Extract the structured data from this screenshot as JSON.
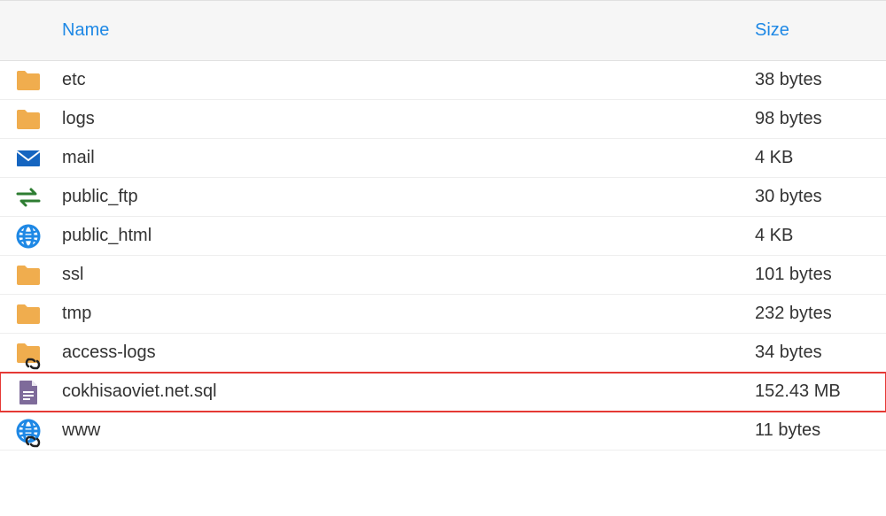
{
  "header": {
    "name": "Name",
    "size": "Size"
  },
  "rows": [
    {
      "icon": "folder",
      "name": "etc",
      "size": "38 bytes",
      "highlight": false
    },
    {
      "icon": "folder",
      "name": "logs",
      "size": "98 bytes",
      "highlight": false
    },
    {
      "icon": "mail",
      "name": "mail",
      "size": "4 KB",
      "highlight": false
    },
    {
      "icon": "ftp",
      "name": "public_ftp",
      "size": "30 bytes",
      "highlight": false
    },
    {
      "icon": "globe",
      "name": "public_html",
      "size": "4 KB",
      "highlight": false
    },
    {
      "icon": "folder",
      "name": "ssl",
      "size": "101 bytes",
      "highlight": false
    },
    {
      "icon": "folder",
      "name": "tmp",
      "size": "232 bytes",
      "highlight": false
    },
    {
      "icon": "folder-link",
      "name": "access-logs",
      "size": "34 bytes",
      "highlight": false
    },
    {
      "icon": "file",
      "name": "cokhisaoviet.net.sql",
      "size": "152.43 MB",
      "highlight": true
    },
    {
      "icon": "globe-link",
      "name": "www",
      "size": "11 bytes",
      "highlight": false
    }
  ],
  "colors": {
    "folder": "#f0ad4e",
    "mail": "#1565c0",
    "ftp": "#2e7d32",
    "globe": "#1e88e5",
    "file": "#7e6b9a",
    "highlight": "#e53935"
  }
}
